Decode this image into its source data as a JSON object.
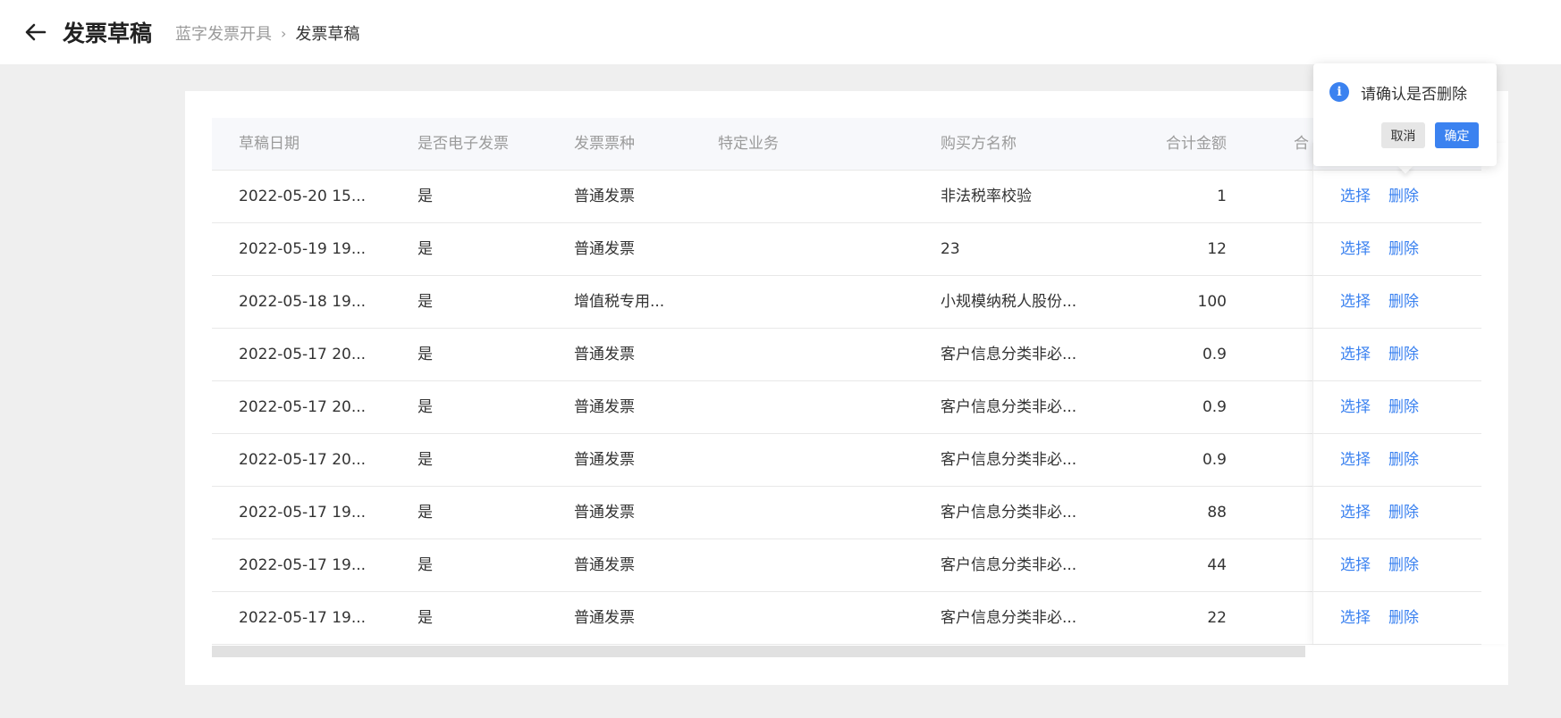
{
  "header": {
    "title": "发票草稿",
    "breadcrumb_parent": "蓝字发票开具",
    "breadcrumb_sep": "›",
    "breadcrumb_current": "发票草稿"
  },
  "table": {
    "columns": [
      "草稿日期",
      "是否电子发票",
      "发票票种",
      "特定业务",
      "购买方名称",
      "合计金额",
      "合"
    ],
    "rows": [
      {
        "date": "2022-05-20 15...",
        "electronic": "是",
        "type": "普通发票",
        "business": "",
        "buyer": "非法税率校验",
        "amount": "1",
        "select": "选择",
        "delete": "删除"
      },
      {
        "date": "2022-05-19 19...",
        "electronic": "是",
        "type": "普通发票",
        "business": "",
        "buyer": "23",
        "amount": "12",
        "select": "选择",
        "delete": "删除"
      },
      {
        "date": "2022-05-18 19...",
        "electronic": "是",
        "type": "增值税专用...",
        "business": "",
        "buyer": "小规模纳税人股份...",
        "amount": "100",
        "select": "选择",
        "delete": "删除"
      },
      {
        "date": "2022-05-17 20...",
        "electronic": "是",
        "type": "普通发票",
        "business": "",
        "buyer": "客户信息分类非必...",
        "amount": "0.9",
        "select": "选择",
        "delete": "删除"
      },
      {
        "date": "2022-05-17 20...",
        "electronic": "是",
        "type": "普通发票",
        "business": "",
        "buyer": "客户信息分类非必...",
        "amount": "0.9",
        "select": "选择",
        "delete": "删除"
      },
      {
        "date": "2022-05-17 20...",
        "electronic": "是",
        "type": "普通发票",
        "business": "",
        "buyer": "客户信息分类非必...",
        "amount": "0.9",
        "select": "选择",
        "delete": "删除"
      },
      {
        "date": "2022-05-17 19...",
        "electronic": "是",
        "type": "普通发票",
        "business": "",
        "buyer": "客户信息分类非必...",
        "amount": "88",
        "select": "选择",
        "delete": "删除"
      },
      {
        "date": "2022-05-17 19...",
        "electronic": "是",
        "type": "普通发票",
        "business": "",
        "buyer": "客户信息分类非必...",
        "amount": "44",
        "select": "选择",
        "delete": "删除"
      },
      {
        "date": "2022-05-17 19...",
        "electronic": "是",
        "type": "普通发票",
        "business": "",
        "buyer": "客户信息分类非必...",
        "amount": "22",
        "select": "选择",
        "delete": "删除"
      }
    ]
  },
  "popover": {
    "icon": "info-icon",
    "icon_glyph": "i",
    "message": "请确认是否删除",
    "cancel_label": "取消",
    "confirm_label": "确定"
  },
  "colors": {
    "accent": "#3b82f0",
    "background": "#efefef",
    "header_bg": "#f7f8fb"
  }
}
